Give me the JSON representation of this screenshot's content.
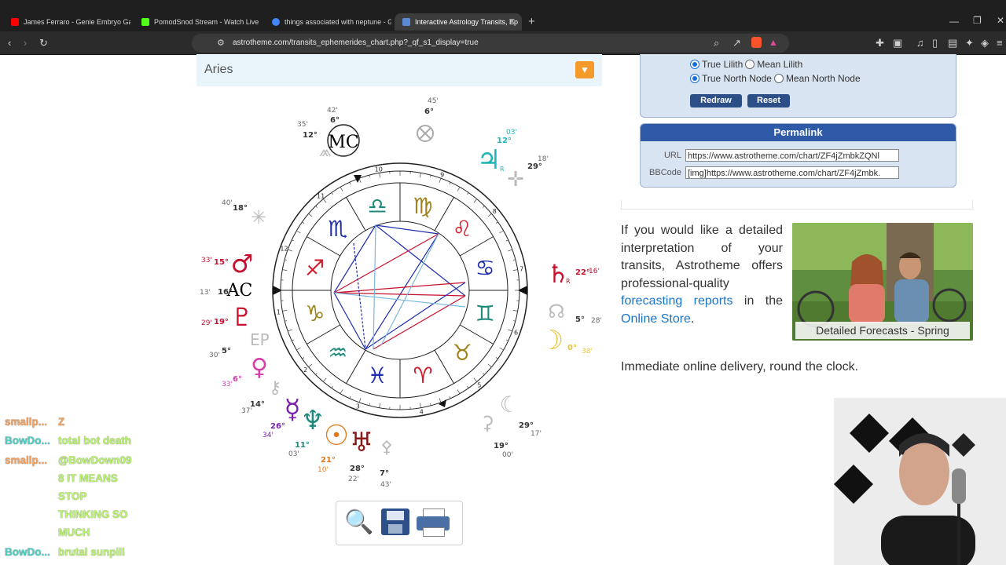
{
  "browser": {
    "tabs": [
      {
        "label": "James Ferraro - Genie Embryo Ga",
        "active": false
      },
      {
        "label": "PomodSnod Stream - Watch Live",
        "active": false
      },
      {
        "label": "things associated with neptune - Go",
        "active": false
      },
      {
        "label": "Interactive Astrology Transits, Ep",
        "active": true
      }
    ],
    "new_tab": "+",
    "url": "astrotheme.com/transits_ephemerides_chart.php?_qf_s1_display=true"
  },
  "chart_header": {
    "label": "Aries"
  },
  "options": {
    "radio_rows": [
      {
        "a": "True Lilith",
        "b": "Mean Lilith"
      },
      {
        "a": "True North Node",
        "b": "Mean North Node"
      }
    ],
    "redraw": "Redraw",
    "reset": "Reset"
  },
  "permalink": {
    "title": "Permalink",
    "url_label": "URL",
    "url_value": "https://www.astrotheme.com/chart/ZF4jZmbkZQNl",
    "bbcode_label": "BBCode",
    "bbcode_value": "[img]https://www.astrotheme.com/chart/ZF4jZmbk."
  },
  "promo": {
    "text_1": "If you would like a detailed interpretation of your transits, Astrotheme offers professional-quality ",
    "link_1": "forecasting reports",
    "text_2": " in the ",
    "link_2": "Online Store",
    "text_3": ".",
    "caption": "Detailed Forecasts - Spring",
    "delivery": "Immediate online delivery, round the clock."
  },
  "wheel": {
    "signs": [
      "♍",
      "♌",
      "♋",
      "♊",
      "♉",
      "♈",
      "♓",
      "♒",
      "♑",
      "♐",
      "♏",
      "♎"
    ],
    "sign_colors": [
      "#a0821a",
      "#d11a2a",
      "#1f2fb0",
      "#1f8a7a",
      "#a0821a",
      "#d11a2a",
      "#1f2fb0",
      "#1f8a7a",
      "#a0821a",
      "#d11a2a",
      "#1f2fb0",
      "#1f8a7a"
    ],
    "house_numbers": [
      "9",
      "8",
      "7",
      "6",
      "5",
      "4",
      "3",
      "2",
      "1",
      "12",
      "11",
      "10"
    ],
    "angle_labels": {
      "mc": "MC",
      "ac": "AC"
    },
    "planets": [
      {
        "glyph": "♃",
        "color": "#1fb5b5",
        "deg": "12°",
        "min": "03'",
        "r": "R"
      },
      {
        "glyph": "♄",
        "color": "#c8102e",
        "deg": "22°",
        "min": "16'",
        "r": "R"
      },
      {
        "glyph": "☽",
        "color": "#e6c43a",
        "deg": "0°",
        "min": "38'"
      },
      {
        "glyph": "♂",
        "color": "#c8102e",
        "deg": "15°",
        "min": "33'"
      },
      {
        "glyph": "♇",
        "color": "#c8102e",
        "deg": "19°",
        "min": "29'"
      },
      {
        "glyph": "♀",
        "color": "#d63fa8",
        "deg": "6°",
        "min": "33'"
      },
      {
        "glyph": "☿",
        "color": "#7a1fb0",
        "deg": "26°",
        "min": "34'"
      },
      {
        "glyph": "♆",
        "color": "#1f8a7a",
        "deg": "11°",
        "min": "03'"
      },
      {
        "glyph": "☉",
        "color": "#e07a1a",
        "deg": "21°",
        "min": "10'"
      },
      {
        "glyph": "♅",
        "color": "#8a1a1a",
        "deg": "28°",
        "min": "22'"
      }
    ],
    "others": [
      {
        "deg": "6°",
        "min": "45'"
      },
      {
        "deg": "12°",
        "min": "35'"
      },
      {
        "deg": "6°",
        "min": "42'"
      },
      {
        "deg": "29°",
        "min": "18'"
      },
      {
        "deg": "18°",
        "min": "40'"
      },
      {
        "deg": "5°",
        "min": "28'"
      },
      {
        "deg": "29°",
        "min": "17'"
      },
      {
        "deg": "19°",
        "min": "00'"
      },
      {
        "deg": "7°",
        "min": "43'"
      },
      {
        "deg": "14°",
        "min": "37'"
      },
      {
        "deg": "5°",
        "min": "30'"
      }
    ],
    "ac_deg": "16°",
    "ac_min": "13'",
    "ep_label": "EP"
  },
  "chat": [
    {
      "user": "smallp...",
      "user_color": "#f5a25d",
      "msg": "Z",
      "msg_color": "#f5a25d"
    },
    {
      "user": "BowDo...",
      "user_color": "#4fd1c5",
      "msg": "total bot death",
      "msg_color": "#b9f56a"
    },
    {
      "user": "smallp...",
      "user_color": "#f5a25d",
      "msg": "@BowDown09",
      "msg_color": "#b9f56a"
    },
    {
      "user": "",
      "user_color": "#f5a25d",
      "msg": "8 IT MEANS",
      "msg_color": "#b9f56a"
    },
    {
      "user": "",
      "user_color": "#f5a25d",
      "msg": "STOP",
      "msg_color": "#b9f56a"
    },
    {
      "user": "",
      "user_color": "#f5a25d",
      "msg": "THINKING SO",
      "msg_color": "#b9f56a"
    },
    {
      "user": "",
      "user_color": "#f5a25d",
      "msg": "MUCH",
      "msg_color": "#b9f56a"
    },
    {
      "user": "BowDo...",
      "user_color": "#4fd1c5",
      "msg": "brutal sunpill",
      "msg_color": "#b9f56a"
    }
  ]
}
